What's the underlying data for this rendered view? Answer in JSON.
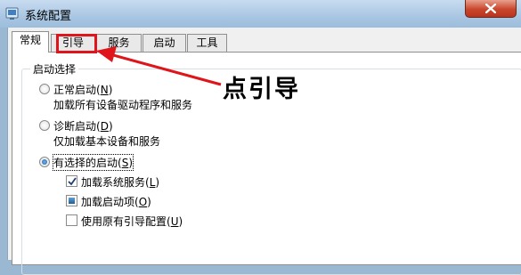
{
  "window": {
    "title": "系统配置"
  },
  "tabs": [
    {
      "label": "常规",
      "active": true
    },
    {
      "label": "引导",
      "active": false
    },
    {
      "label": "服务",
      "active": false
    },
    {
      "label": "启动",
      "active": false
    },
    {
      "label": "工具",
      "active": false
    }
  ],
  "startup": {
    "group_title": "启动选择",
    "normal": {
      "label": "正常启动",
      "key": "N",
      "desc": "加载所有设备驱动程序和服务"
    },
    "diagnostic": {
      "label": "诊断启动",
      "key": "D",
      "desc": "仅加载基本设备和服务"
    },
    "selective": {
      "label": "有选择的启动",
      "key": "S",
      "selected": true
    },
    "options": [
      {
        "label": "加载系统服务",
        "key": "L",
        "state": "checked"
      },
      {
        "label": "加载启动项",
        "key": "O",
        "state": "indeterminate"
      },
      {
        "label": "使用原有引导配置",
        "key": "U",
        "state": "unchecked"
      }
    ]
  },
  "annotation": {
    "text": "点引导",
    "color": "#e0141b"
  },
  "colors": {
    "titlebar": "#a9c6e3",
    "close_button": "#c9462c",
    "radio_selected": "#1b5fa8"
  }
}
